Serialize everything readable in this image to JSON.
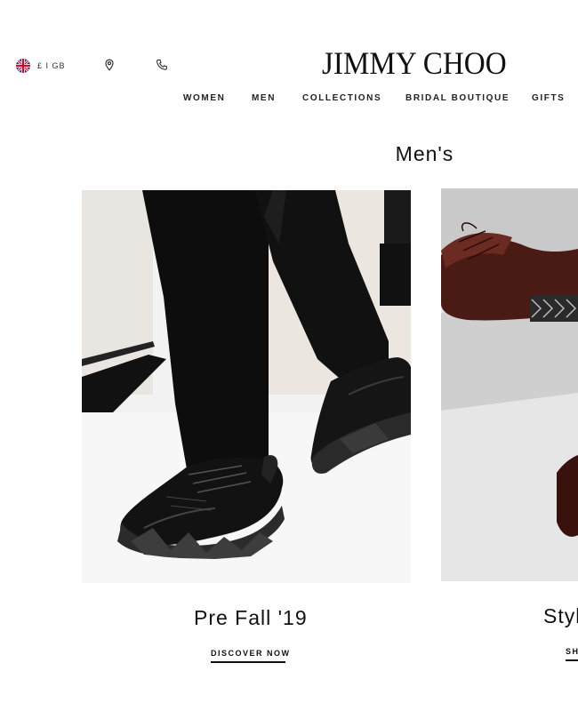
{
  "header": {
    "locale_label": "£ I GB",
    "logo": "JIMMY CHOO",
    "icons": [
      "uk-flag-icon",
      "location-pin-icon",
      "phone-icon"
    ]
  },
  "nav": {
    "items": [
      {
        "label": "WOMEN"
      },
      {
        "label": "MEN"
      },
      {
        "label": "COLLECTIONS"
      },
      {
        "label": "BRIDAL BOUTIQUE"
      },
      {
        "label": "GIFTS"
      }
    ]
  },
  "main": {
    "section_title": "Men's",
    "cards": [
      {
        "title": "Pre Fall '19",
        "link": "DISCOVER NOW"
      },
      {
        "title": "Styl",
        "link": "SH"
      }
    ]
  },
  "colors": {
    "text": "#111111",
    "background": "#ffffff"
  }
}
